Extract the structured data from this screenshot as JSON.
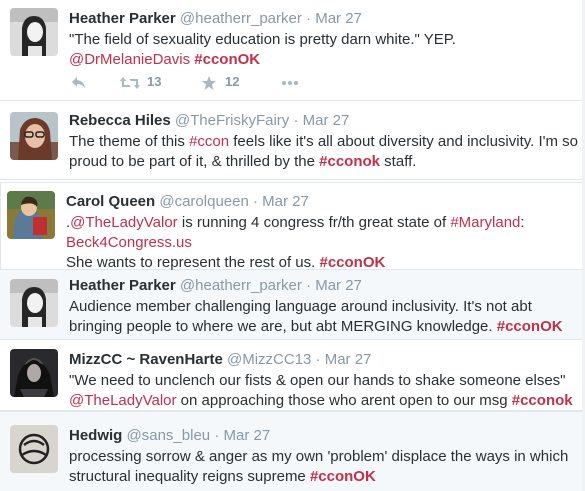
{
  "tweets": [
    {
      "name": "Heather Parker",
      "handle": "@heatherr_parker",
      "date": "Mar 27",
      "segments": [
        {
          "t": "\"The field of sexuality education is pretty darn white.\" YEP. "
        },
        {
          "t": "@DrMelanieDavis",
          "link": true
        },
        {
          "t": " "
        },
        {
          "t": "#cconOK",
          "link": true,
          "bold": true
        }
      ],
      "avatar": "avatar-heather",
      "retweets": "13",
      "favorites": "12"
    },
    {
      "name": "Rebecca Hiles",
      "handle": "@TheFriskyFairy",
      "date": "Mar 27",
      "segments": [
        {
          "t": "The theme of this "
        },
        {
          "t": "#ccon",
          "link": true
        },
        {
          "t": " feels like it's all about diversity and inclusivity. I'm so proud to be part of it, & thrilled by the "
        },
        {
          "t": "#cconok",
          "link": true,
          "bold": true
        },
        {
          "t": " staff."
        }
      ],
      "avatar": "avatar-rebecca"
    },
    {
      "name": "Carol Queen",
      "handle": "@carolqueen",
      "date": "Mar 27",
      "segments": [
        {
          "t": "."
        },
        {
          "t": "@TheLadyValor",
          "link": true
        },
        {
          "t": " is running 4 congress fr/th great state of "
        },
        {
          "t": "#Maryland",
          "link": true
        },
        {
          "t": ":",
          "br": true
        },
        {
          "t": "Beck4Congress.us",
          "link": true,
          "br": true
        },
        {
          "t": "She wants to represent the rest of us. "
        },
        {
          "t": "#cconOK",
          "link": true,
          "bold": true
        }
      ],
      "avatar": "avatar-carol"
    },
    {
      "name": "Heather Parker",
      "handle": "@heatherr_parker",
      "date": "Mar 27",
      "segments": [
        {
          "t": "Audience member challenging language around inclusivity. It's not abt bringing people to where we are, but abt MERGING knowledge. "
        },
        {
          "t": "#cconOK",
          "link": true,
          "bold": true
        }
      ],
      "avatar": "avatar-heather"
    },
    {
      "name": "MizzCC ~ RavenHarte",
      "handle": "@MizzCC13",
      "date": "Mar 27",
      "segments": [
        {
          "t": "\"We need to unclench our fists & open our hands to shake someone elses\"",
          "br": true
        },
        {
          "t": "@TheLadyValor",
          "link": true
        },
        {
          "t": " on approaching those who arent open to our msg "
        },
        {
          "t": "#cconok",
          "link": true,
          "bold": true
        }
      ],
      "avatar": "avatar-raven"
    },
    {
      "name": "Hedwig",
      "handle": "@sans_bleu",
      "date": "Mar 27",
      "segments": [
        {
          "t": "processing sorrow & anger as my own 'problem' displace the ways in which structural inequality reigns supreme "
        },
        {
          "t": "#cconOK",
          "link": true,
          "bold": true
        }
      ],
      "avatar": "avatar-hedwig"
    }
  ],
  "separator": "·",
  "icons": {
    "reply": "reply-icon",
    "retweet": "retweet-icon",
    "favorite": "star-icon",
    "more": "more-icon"
  },
  "colors": {
    "link": "#c0314a",
    "muted": "#8899a6",
    "text": "#292f33",
    "border": "#e1e8ed",
    "shaded": "#f5f8fa"
  }
}
